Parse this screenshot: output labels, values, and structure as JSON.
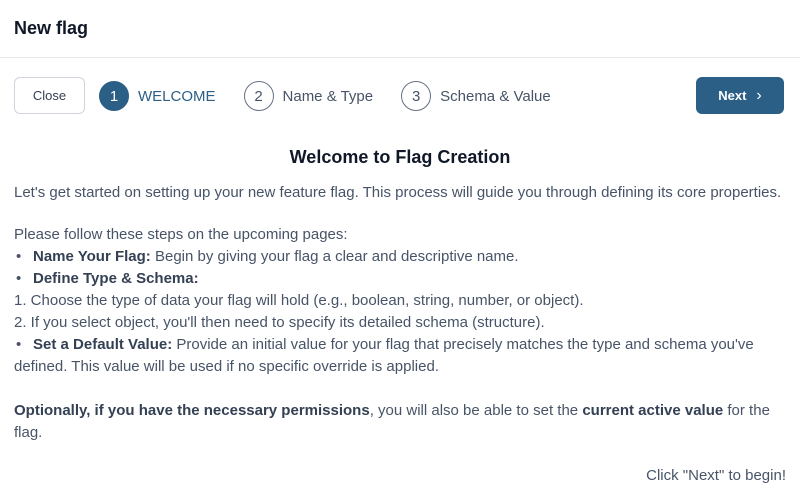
{
  "header": {
    "title": "New flag"
  },
  "toolbar": {
    "close_label": "Close",
    "next_label": "Next",
    "steps": [
      {
        "number": "1",
        "label": "WELCOME"
      },
      {
        "number": "2",
        "label": "Name & Type"
      },
      {
        "number": "3",
        "label": "Schema & Value"
      }
    ]
  },
  "content": {
    "heading": "Welcome to Flag Creation",
    "intro": "Let's get started on setting up your new feature flag. This process will guide you through defining its core properties.",
    "follow": "Please follow these steps on the upcoming pages:",
    "bullets": [
      {
        "title": "Name Your Flag:",
        "text": " Begin by giving your flag a clear and descriptive name."
      },
      {
        "title": "Define Type & Schema:"
      },
      {
        "title": "Set a Default Value:",
        "text": " Provide an initial value for your flag that precisely matches the type and schema you've defined. This value will be used if no specific override is applied."
      }
    ],
    "substeps": [
      "1. Choose the type of data your flag will hold (e.g., boolean, string, number, or object).",
      "2. If you select object, you'll then need to specify its detailed schema (structure)."
    ],
    "optional": {
      "part1": "Optionally, if you have the necessary permissions",
      "part2": ", you will also be able to set the ",
      "part3": "current active value",
      "part4": " for the flag."
    },
    "begin": "Click \"Next\" to begin!"
  }
}
